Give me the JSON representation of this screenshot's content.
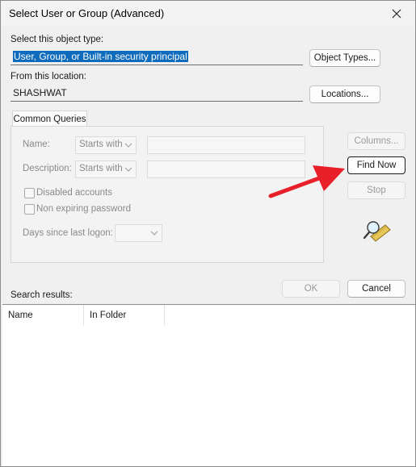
{
  "window": {
    "title": "Select User or Group (Advanced)"
  },
  "object_type": {
    "label": "Select this object type:",
    "value": "User, Group, or Built-in security principal",
    "button": "Object Types..."
  },
  "location": {
    "label": "From this location:",
    "value": "SHASHWAT",
    "button": "Locations..."
  },
  "common_queries": {
    "tab_label": "Common Queries",
    "name_label": "Name:",
    "name_mode": "Starts with",
    "description_label": "Description:",
    "description_mode": "Starts with",
    "disabled_accounts": "Disabled accounts",
    "non_expiring_password": "Non expiring password",
    "days_since_logon_label": "Days since last logon:"
  },
  "side_buttons": {
    "columns": "Columns...",
    "find_now": "Find Now",
    "stop": "Stop"
  },
  "footer": {
    "ok": "OK",
    "cancel": "Cancel"
  },
  "results": {
    "label": "Search results:",
    "columns": [
      "Name",
      "In Folder"
    ]
  },
  "colors": {
    "selection": "#0f6cbd",
    "annotation_arrow": "#e8202a"
  },
  "icons": {
    "close": "close-icon",
    "find": "magnifier-find-icon",
    "chevron": "chevron-down-icon"
  }
}
